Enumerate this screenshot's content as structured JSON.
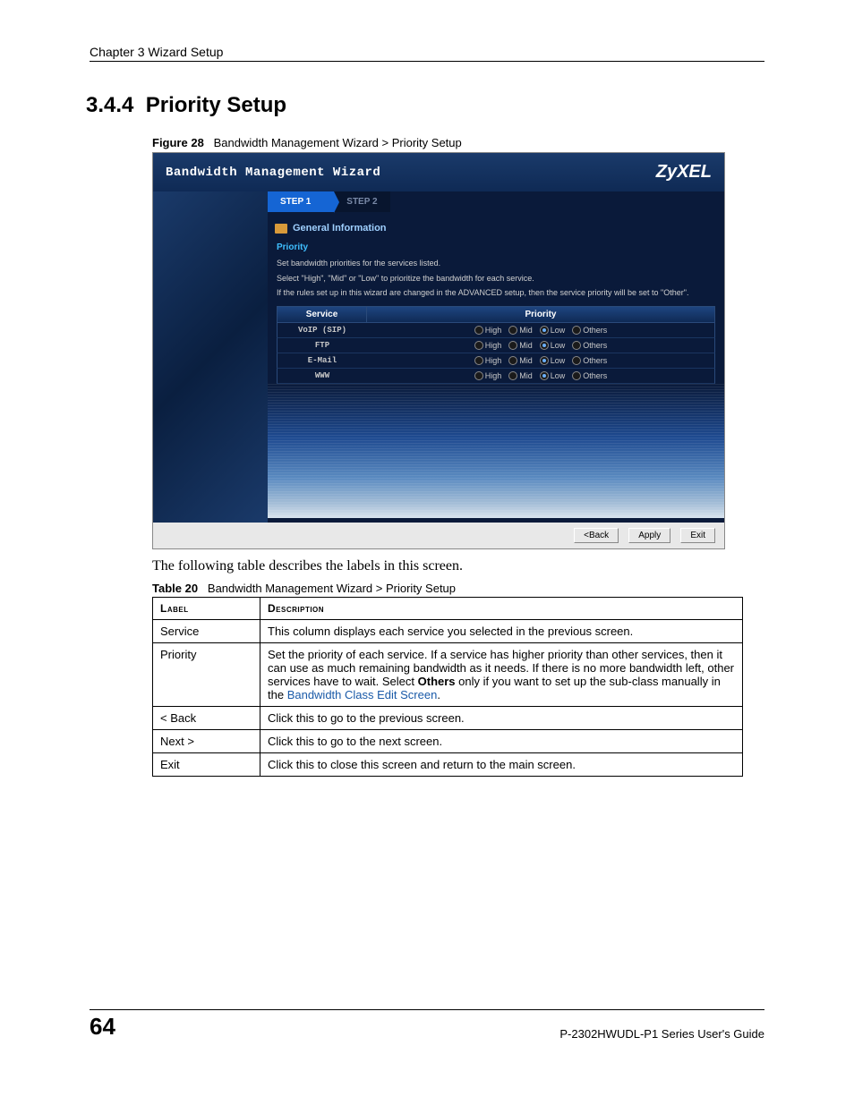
{
  "page": {
    "chapter_header": "Chapter 3 Wizard Setup",
    "section_number": "3.4.4",
    "section_title": "Priority Setup",
    "page_number": "64",
    "guide_ref": "P-2302HWUDL-P1 Series User's Guide"
  },
  "figure": {
    "label_prefix": "Figure 28",
    "label_text": "Bandwidth Management Wizard > Priority Setup"
  },
  "wizard": {
    "title": "Bandwidth Management Wizard",
    "brand": "ZyXEL",
    "steps": {
      "step1": "STEP 1",
      "step2": "STEP 2"
    },
    "subhead": "General Information",
    "priority_heading": "Priority",
    "instruction1": "Set bandwidth priorities for the services listed.",
    "instruction2": "Select \"High\", \"Mid\" or \"Low\" to prioritize the bandwidth for each service.",
    "instruction3": "If the rules set up in this wizard are changed in the ADVANCED setup, then the service priority will be set to \"Other\".",
    "columns": {
      "service": "Service",
      "priority": "Priority"
    },
    "options": {
      "high": "High",
      "mid": "Mid",
      "low": "Low",
      "others": "Others"
    },
    "rows": [
      {
        "service": "VoIP (SIP)",
        "selected": "low"
      },
      {
        "service": "FTP",
        "selected": "low"
      },
      {
        "service": "E-Mail",
        "selected": "low"
      },
      {
        "service": "WWW",
        "selected": "low"
      }
    ],
    "buttons": {
      "back": "<Back",
      "apply": "Apply",
      "exit": "Exit"
    }
  },
  "body_paragraph": "The following table describes the labels in this screen.",
  "table": {
    "caption_prefix": "Table 20",
    "caption_text": "Bandwidth Management Wizard > Priority Setup",
    "headers": {
      "label": "Label",
      "description": "Description"
    },
    "rows": {
      "service": {
        "label": "Service",
        "desc": "This column displays each service you selected in the previous screen."
      },
      "priority": {
        "label": "Priority",
        "desc_pre": "Set the priority of each service. If a service has higher priority than other services, then it can use as much remaining bandwidth as it needs. If there is no more bandwidth left, other services have to wait. Select ",
        "desc_bold": "Others",
        "desc_mid": " only if you want to set up the sub-class manually in the ",
        "desc_link": "Bandwidth Class Edit Screen",
        "desc_post": "."
      },
      "back": {
        "label": "< Back",
        "desc": "Click this to go to the previous screen."
      },
      "next": {
        "label": "Next >",
        "desc": "Click this to go to the next screen."
      },
      "exit": {
        "label": "Exit",
        "desc": "Click this to close this screen and return to the main screen."
      }
    }
  }
}
